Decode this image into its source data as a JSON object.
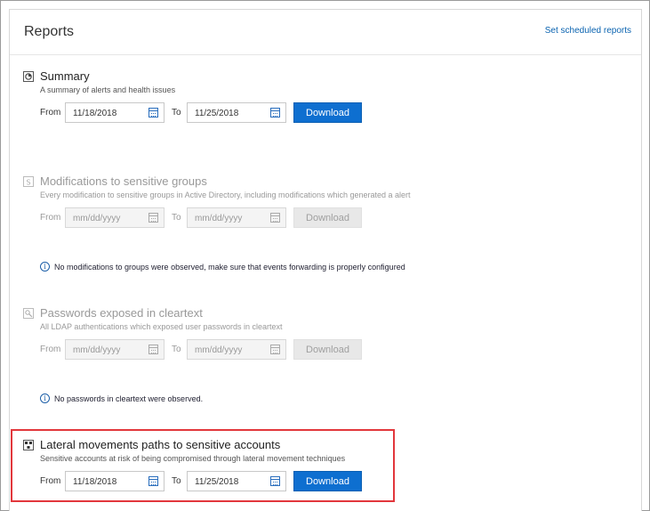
{
  "header": {
    "title": "Reports",
    "scheduled_link": "Set scheduled reports"
  },
  "reports": [
    {
      "icon": "summary-report-icon",
      "title": "Summary",
      "description": "A summary of alerts and health issues",
      "from_label": "From",
      "to_label": "To",
      "from_value": "11/18/2018",
      "to_value": "11/25/2018",
      "button": "Download",
      "enabled": true
    },
    {
      "icon": "sensitive-groups-icon",
      "title": "Modifications to sensitive groups",
      "description": "Every modification to sensitive groups in Active Directory, including modifications which generated a alert",
      "from_label": "From",
      "to_label": "To",
      "from_placeholder": "mm/dd/yyyy",
      "to_placeholder": "mm/dd/yyyy",
      "button": "Download",
      "enabled": false,
      "notice": "No modifications to groups were observed, make sure that events forwarding is properly configured"
    },
    {
      "icon": "cleartext-password-icon",
      "title": "Passwords exposed in cleartext",
      "description": "All LDAP authentications which exposed user passwords in cleartext",
      "from_label": "From",
      "to_label": "To",
      "from_placeholder": "mm/dd/yyyy",
      "to_placeholder": "mm/dd/yyyy",
      "button": "Download",
      "enabled": false,
      "notice": "No passwords in cleartext were observed."
    },
    {
      "icon": "lateral-movement-icon",
      "title": "Lateral movements paths to sensitive accounts",
      "description": "Sensitive accounts at risk of being compromised through lateral movement techniques",
      "from_label": "From",
      "to_label": "To",
      "from_value": "11/18/2018",
      "to_value": "11/25/2018",
      "button": "Download",
      "enabled": true
    }
  ],
  "colors": {
    "accent": "#0e6fd0",
    "link": "#0a63b0",
    "highlight": "#e2373c"
  }
}
